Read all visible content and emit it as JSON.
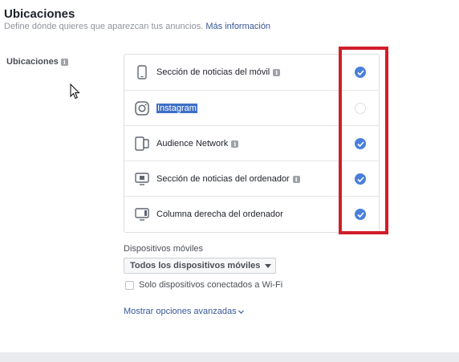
{
  "header": {
    "title": "Ubicaciones",
    "subtitle": "Define dónde quieres que aparezcan tus anuncios.",
    "more_info_link": "Más información"
  },
  "placements": {
    "label": "Ubicaciones",
    "items": [
      {
        "label": "Sección de noticias del móvil",
        "icon": "mobile-phone-icon",
        "checked": true,
        "has_info": true
      },
      {
        "label": "Instagram",
        "icon": "instagram-icon",
        "checked": false,
        "has_info": false,
        "selected_text": true
      },
      {
        "label": "Audience Network",
        "icon": "audience-network-icon",
        "checked": true,
        "has_info": true
      },
      {
        "label": "Sección de noticias del ordenador",
        "icon": "desktop-monitor-icon",
        "checked": true,
        "has_info": true
      },
      {
        "label": "Columna derecha del ordenador",
        "icon": "desktop-right-column-icon",
        "checked": true,
        "has_info": false
      }
    ]
  },
  "mobile_devices": {
    "label": "Dispositivos móviles",
    "selected": "Todos los dispositivos móviles",
    "wifi_only_label": "Solo dispositivos conectados a Wi-Fi",
    "wifi_only_checked": false
  },
  "advanced_link": "Mostrar opciones avanzadas",
  "colors": {
    "accent": "#4a7fdb",
    "link": "#365899",
    "highlight_box": "#d01f2a",
    "text_selection": "#3d6fc7"
  }
}
